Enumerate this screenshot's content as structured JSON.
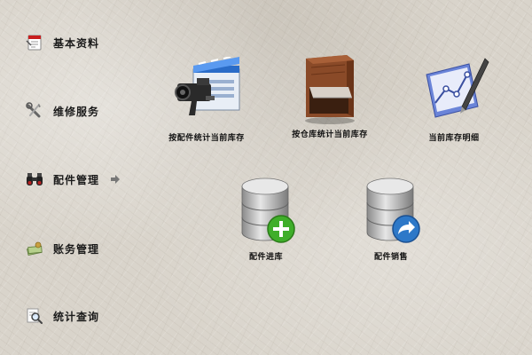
{
  "sidebar": {
    "items": [
      {
        "label": "基本资料",
        "icon": "calendar-document-icon"
      },
      {
        "label": "维修服务",
        "icon": "tools-icon"
      },
      {
        "label": "配件管理",
        "icon": "binoculars-icon",
        "active": true
      },
      {
        "label": "账务管理",
        "icon": "money-icon"
      },
      {
        "label": "统计查询",
        "icon": "magnifier-document-icon"
      }
    ],
    "active_arrow_icon": "arrow-right-icon"
  },
  "main": {
    "tiles": [
      {
        "label": "按配件统计当前库存",
        "icon": "camera-clapper-icon"
      },
      {
        "label": "按仓库统计当前库存",
        "icon": "warehouse-icon"
      },
      {
        "label": "当前库存明细",
        "icon": "graph-pen-icon"
      },
      {
        "label": "配件进库",
        "icon": "database-add-icon"
      },
      {
        "label": "配件销售",
        "icon": "database-forward-icon"
      }
    ]
  },
  "colors": {
    "background": "#d9d4cb",
    "text": "#1a1a1a",
    "add_badge": "#3fae2a",
    "forward_badge": "#2d78c8"
  }
}
